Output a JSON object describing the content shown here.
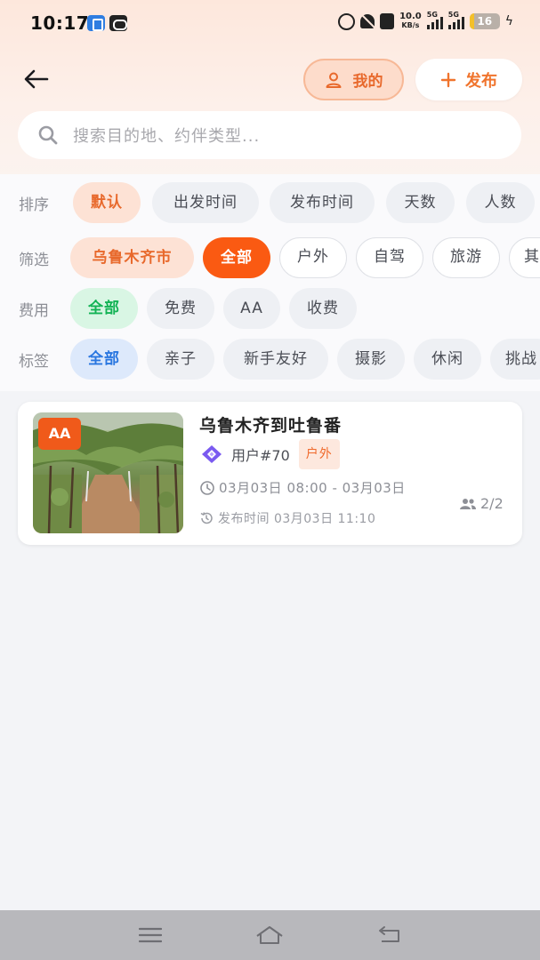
{
  "status_bar": {
    "time": "10:17",
    "net_speed_value": "10.0",
    "net_speed_unit": "KB/s",
    "sim1_label": "5G",
    "sim2_label": "5G",
    "battery_level": "16",
    "battery_fraction": 0.16
  },
  "header": {
    "back_icon": "arrow-left-icon",
    "mine_label": "我的",
    "mine_icon": "user-icon",
    "publish_label": "发布",
    "publish_icon": "plus-icon"
  },
  "search": {
    "placeholder": "搜索目的地、约伴类型..."
  },
  "filters": {
    "sort": {
      "label": "排序",
      "options": [
        "默认",
        "出发时间",
        "发布时间",
        "天数",
        "人数"
      ],
      "selected": "默认"
    },
    "filter": {
      "label": "筛选",
      "city": "乌鲁木齐市",
      "options": [
        "全部",
        "户外",
        "自驾",
        "旅游",
        "其"
      ],
      "selected": "全部"
    },
    "fee": {
      "label": "费用",
      "options": [
        "全部",
        "免费",
        "AA",
        "收费"
      ],
      "selected": "全部"
    },
    "tags": {
      "label": "标签",
      "options": [
        "全部",
        "亲子",
        "新手友好",
        "摄影",
        "休闲",
        "挑战"
      ],
      "selected": "全部"
    }
  },
  "cards": [
    {
      "badge": "AA",
      "title": "乌鲁木齐到吐鲁番",
      "user": "用户#70",
      "category": "户外",
      "time_range": "03月03日 08:00 - 03月03日",
      "published": "发布时间 03月03日 11:10",
      "people": "2/2"
    }
  ],
  "colors": {
    "accent": "#fa5a12",
    "accent_soft": "#fde2d5",
    "green": "#13b355",
    "blue": "#2a77e0"
  }
}
